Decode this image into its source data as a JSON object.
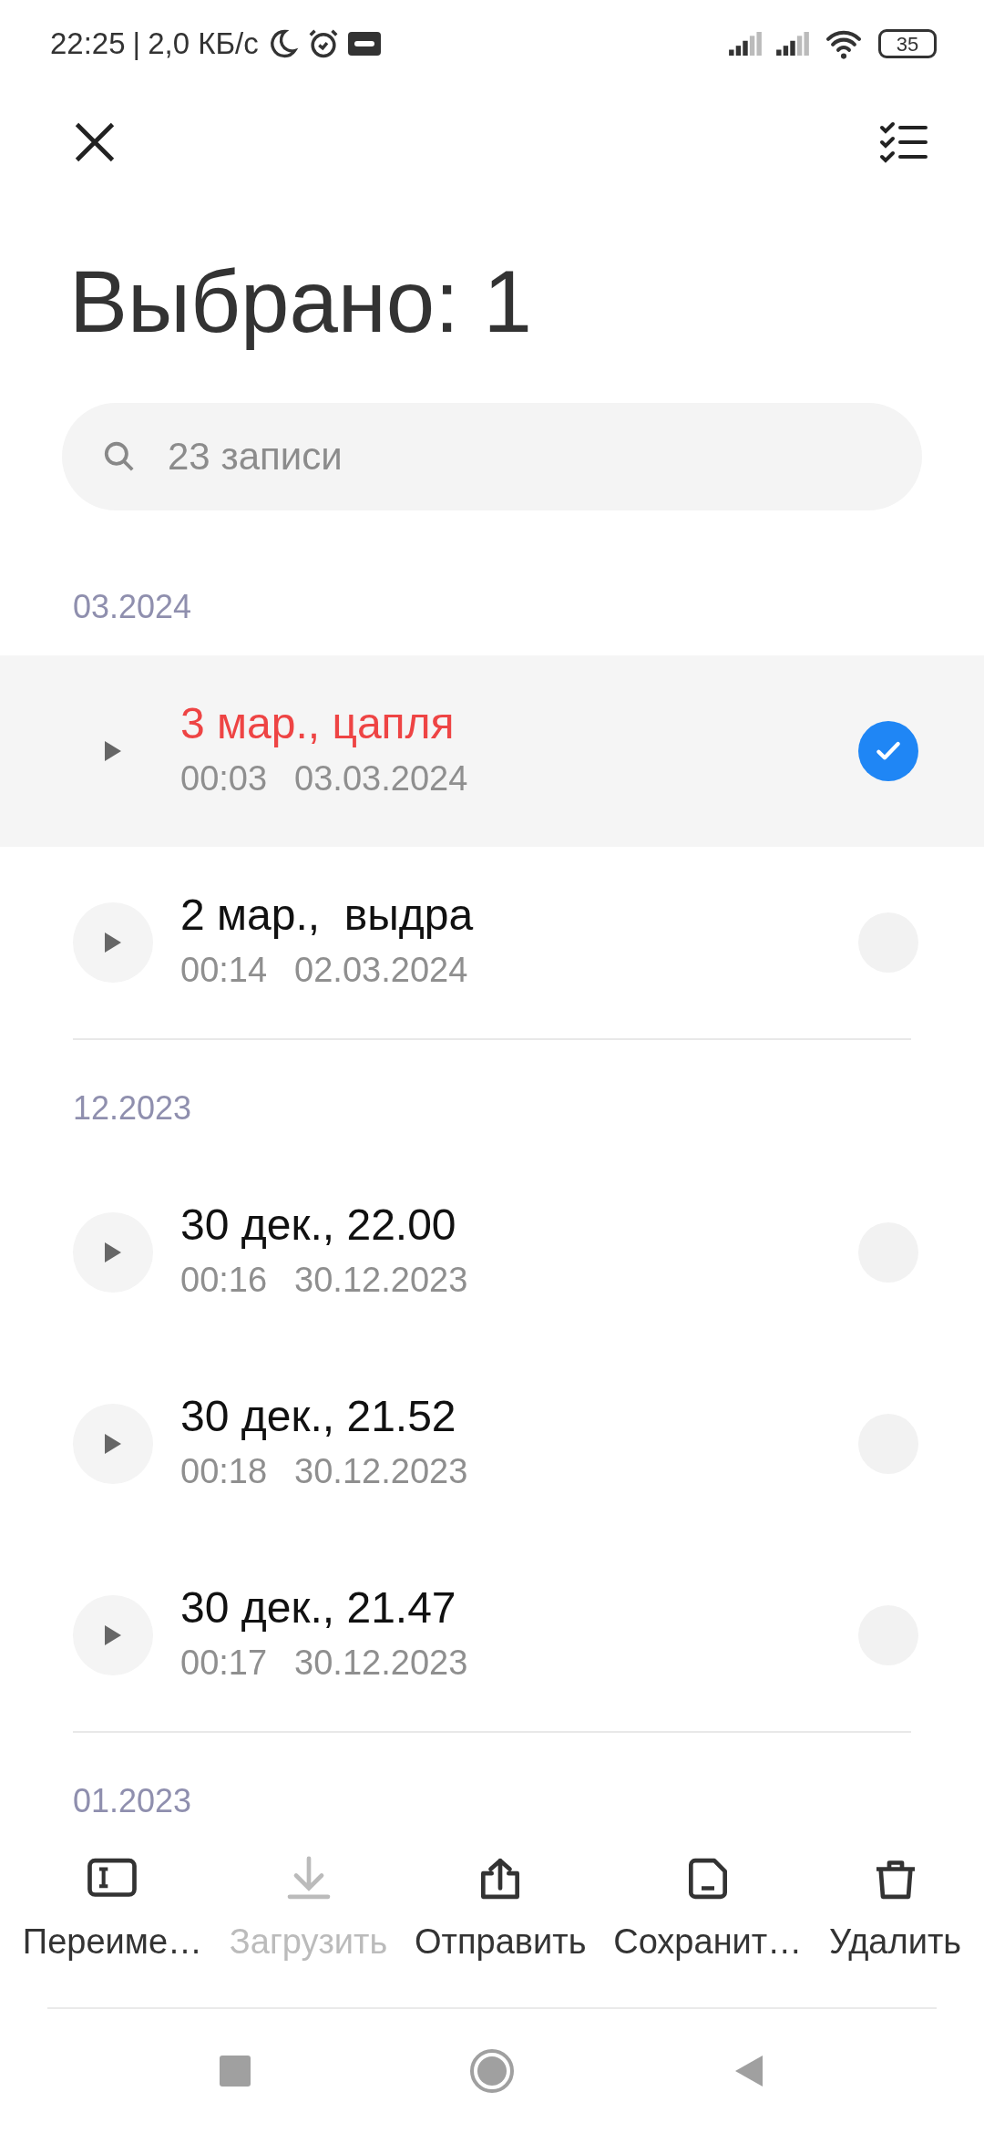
{
  "status_bar": {
    "time": "22:25",
    "separator": "|",
    "speed": "2,0 КБ/с",
    "battery": "35"
  },
  "header": {
    "title": "Выбрано: 1"
  },
  "search": {
    "placeholder": "23 записи"
  },
  "groups": [
    {
      "label": "03.2024",
      "items": [
        {
          "title": "3 мар., цапля",
          "duration": "00:03",
          "date": "03.03.2024",
          "selected": true
        },
        {
          "title": "2 мар.,  выдра",
          "duration": "00:14",
          "date": "02.03.2024",
          "selected": false
        }
      ]
    },
    {
      "label": "12.2023",
      "items": [
        {
          "title": "30 дек., 22.00",
          "duration": "00:16",
          "date": "30.12.2023",
          "selected": false
        },
        {
          "title": "30 дек., 21.52",
          "duration": "00:18",
          "date": "30.12.2023",
          "selected": false
        },
        {
          "title": "30 дек., 21.47",
          "duration": "00:17",
          "date": "30.12.2023",
          "selected": false
        }
      ]
    },
    {
      "label": "01.2023"
    }
  ],
  "actions": [
    {
      "kind": "rename",
      "label": "Переиме…",
      "disabled": false
    },
    {
      "kind": "download",
      "label": "Загрузить",
      "disabled": true
    },
    {
      "kind": "share",
      "label": "Отправить",
      "disabled": false
    },
    {
      "kind": "save",
      "label": "Сохранит…",
      "disabled": false
    },
    {
      "kind": "delete",
      "label": "Удалить",
      "disabled": false
    }
  ]
}
